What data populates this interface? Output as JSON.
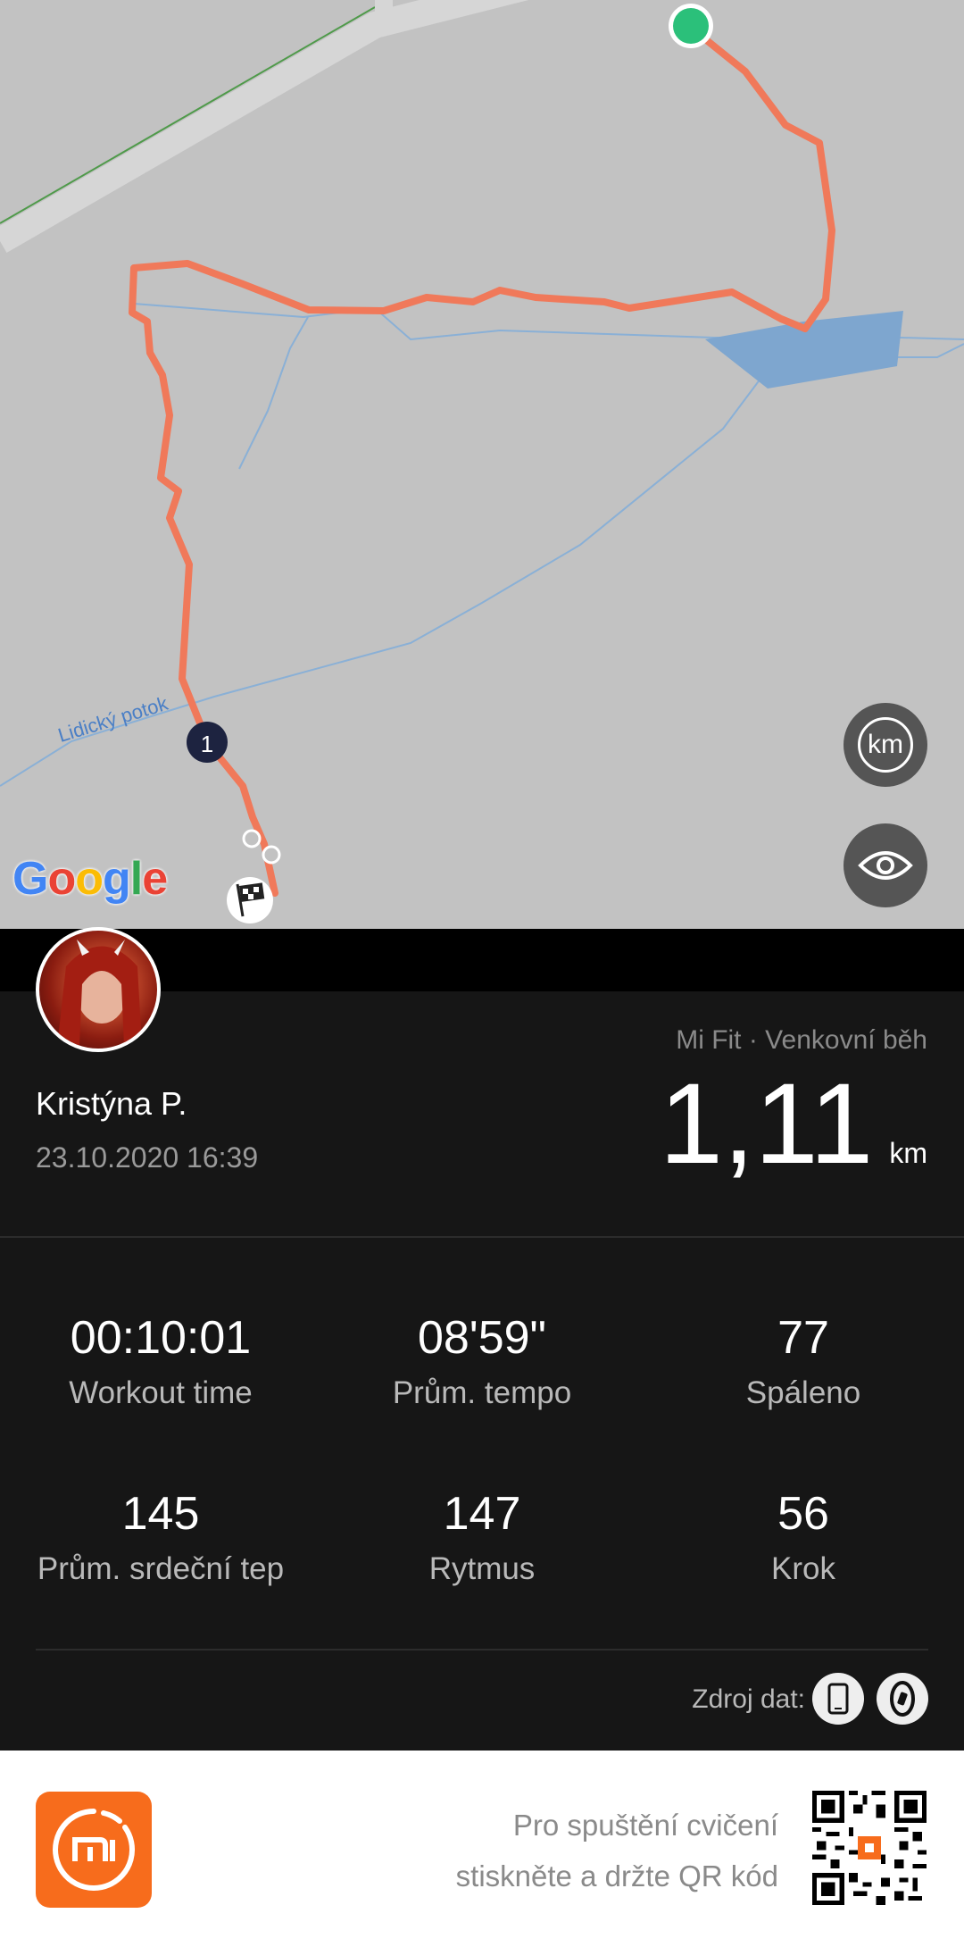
{
  "map": {
    "river_label": "Lidický potok",
    "google_logo": "Google",
    "lap_marker": "1",
    "unit_button": "km",
    "start_icon": "green-start-dot",
    "finish_icon": "checkered-flag-icon",
    "visibility_icon": "eye-icon",
    "route_color": "#f0795a",
    "water_color": "#7ea6cf"
  },
  "user": {
    "name": "Kristýna P.",
    "date": "23.10.2020 16:39"
  },
  "summary": {
    "source_app": "Mi Fit · Venkovní běh",
    "distance_value": "1,11",
    "distance_unit": "km"
  },
  "stats": [
    {
      "value": "00:10:01",
      "label": "Workout time"
    },
    {
      "value": "08'59\"",
      "label": "Prům. tempo"
    },
    {
      "value": "77",
      "label": "Spáleno"
    },
    {
      "value": "145",
      "label": "Prům. srdeční tep"
    },
    {
      "value": "147",
      "label": "Rytmus"
    },
    {
      "value": "56",
      "label": "Krok"
    }
  ],
  "data_source": {
    "label": "Zdroj dat:",
    "icons": [
      "phone-icon",
      "band-icon"
    ]
  },
  "footer": {
    "line1": "Pro spuštění cvičení",
    "line2": "stiskněte a držte QR kód",
    "logo": "mi-logo",
    "qr": "qr-code",
    "accent_color": "#f76c1c"
  }
}
